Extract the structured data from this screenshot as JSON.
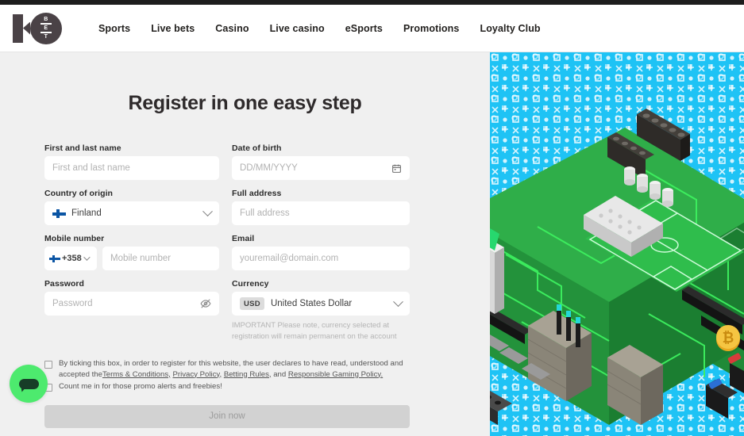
{
  "brand": {
    "logo_text": "10BET",
    "logo_inner": [
      "B",
      "E",
      "T"
    ]
  },
  "nav": {
    "items": [
      {
        "label": "Sports"
      },
      {
        "label": "Live bets"
      },
      {
        "label": "Casino"
      },
      {
        "label": "Live casino"
      },
      {
        "label": "eSports"
      },
      {
        "label": "Promotions"
      },
      {
        "label": "Loyalty Club"
      }
    ]
  },
  "page": {
    "title": "Register in one easy step"
  },
  "form": {
    "name": {
      "label": "First and last name",
      "placeholder": "First and last name",
      "value": ""
    },
    "dob": {
      "label": "Date of birth",
      "placeholder": "DD/MM/YYYY",
      "value": "",
      "icon": "calendar-icon"
    },
    "country": {
      "label": "Country of origin",
      "value": "Finland",
      "flag": "finland-flag-icon"
    },
    "address": {
      "label": "Full address",
      "placeholder": "Full address",
      "value": ""
    },
    "mobile": {
      "label": "Mobile number",
      "prefix": "+358",
      "placeholder": "Mobile number",
      "value": ""
    },
    "email": {
      "label": "Email",
      "placeholder": "youremail@domain.com",
      "value": ""
    },
    "password": {
      "label": "Password",
      "placeholder": "Password",
      "value": "",
      "icon": "eye-off-icon"
    },
    "currency": {
      "label": "Currency",
      "code": "USD",
      "value": "United States Dollar",
      "note": "IMPORTANT Please note, currency selected at registration will remain permanent on the account"
    }
  },
  "terms": {
    "checkbox1": {
      "checked": false,
      "text_before": "By ticking this box, in order to register for this website, the user declares to have read, understood and accepted the",
      "links": [
        {
          "label": "Terms & Conditions,"
        },
        {
          "label": "Privacy Policy,"
        },
        {
          "label": "Betting Rules,"
        }
      ],
      "conjunction": "and",
      "last_link": {
        "label": "Responsible Gaming Policy."
      }
    },
    "checkbox2": {
      "checked": false,
      "text": "Count me in for those promo alerts and freebies!"
    }
  },
  "submit": {
    "label": "Join now",
    "enabled": false
  },
  "chat": {
    "name": "chat-widget",
    "icon": "chat-bubble-icon",
    "color": "#4dea6e"
  },
  "hero": {
    "alt": "Isometric circuit board with football pitch",
    "bg_color": "#1ec3f5",
    "board_color": "#2a9d3f",
    "trace_color": "#34e85a"
  },
  "colors": {
    "page_bg": "#f0f0f0",
    "header_bg": "#ffffff",
    "text": "#2b2b2b",
    "accent_cyan": "#1ec3f5",
    "flag_blue": "#0b55a4",
    "disabled_btn": "#d2d2d2"
  }
}
